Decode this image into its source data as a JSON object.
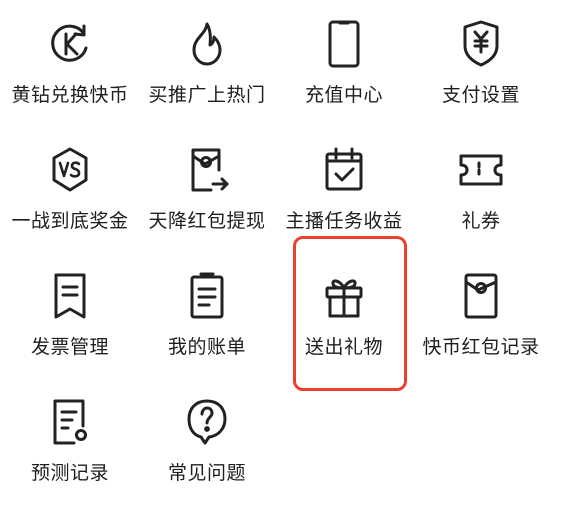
{
  "menu": {
    "items": [
      {
        "label": "黄钻兑换快币",
        "icon": "k-coin-exchange-icon"
      },
      {
        "label": "买推广上热门",
        "icon": "flame-icon"
      },
      {
        "label": "充值中心",
        "icon": "phone-icon"
      },
      {
        "label": "支付设置",
        "icon": "yuan-shield-icon"
      },
      {
        "label": "一战到底奖金",
        "icon": "vs-badge-icon"
      },
      {
        "label": "天降红包提现",
        "icon": "red-packet-withdraw-icon"
      },
      {
        "label": "主播任务收益",
        "icon": "calendar-check-icon"
      },
      {
        "label": "礼券",
        "icon": "ticket-icon"
      },
      {
        "label": "发票管理",
        "icon": "invoice-icon"
      },
      {
        "label": "我的账单",
        "icon": "bill-icon"
      },
      {
        "label": "送出礼物",
        "icon": "gift-icon"
      },
      {
        "label": "快币红包记录",
        "icon": "red-packet-record-icon"
      },
      {
        "label": "预测记录",
        "icon": "prediction-record-icon"
      },
      {
        "label": "常见问题",
        "icon": "question-bubble-icon"
      }
    ]
  },
  "highlight": {
    "item": "送出礼物",
    "color": "#e8412c"
  },
  "icon_color": "#222222"
}
